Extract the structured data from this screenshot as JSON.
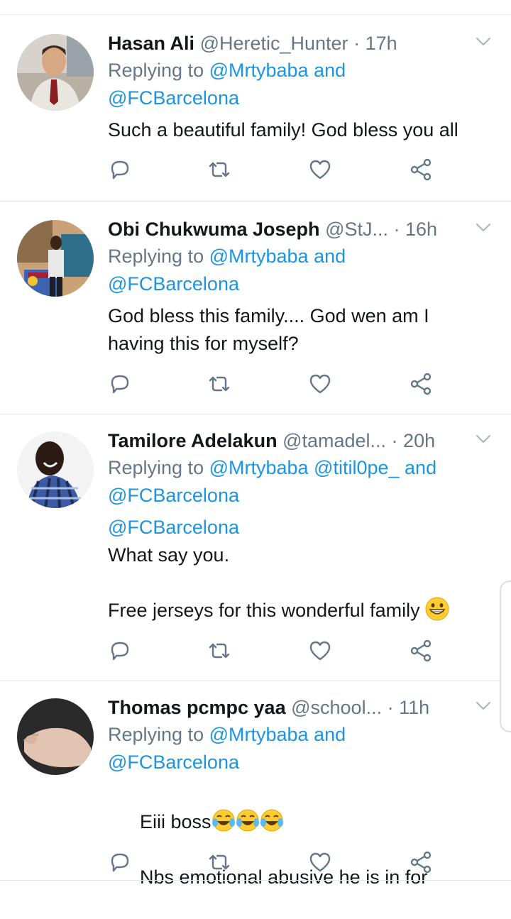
{
  "tweets": [
    {
      "name": "Hasan Ali",
      "handle": "@Heretic_Hunter",
      "dot": " · ",
      "time": "17h",
      "replying_prefix": "Replying to ",
      "replying_line1_mentions": "@Mrtybaba",
      "replying_and": " and",
      "replying_line2": "@FCBarcelona",
      "body": "Such a beautiful family! God bless you all"
    },
    {
      "name": "Obi Chukwuma Joseph",
      "handle": "@StJ...",
      "dot": " · ",
      "time": "16h",
      "replying_prefix": "Replying to ",
      "replying_line1_mentions": "@Mrtybaba",
      "replying_and": " and",
      "replying_line2": "@FCBarcelona",
      "body": "God bless this family.... God wen am I\nhaving this for myself?"
    },
    {
      "name": "Tamilore Adelakun",
      "handle": "@tamadel...",
      "dot": " · ",
      "time": "20h",
      "replying_prefix": "Replying to ",
      "replying_line1_mentions": "@Mrtybaba @titil0pe_",
      "replying_and": " and",
      "replying_line2": "@FCBarcelona",
      "body_mention": "@FCBarcelona",
      "body": "What say you.\n\nFree jerseys for this wonderful family "
    },
    {
      "name": "Thomas pcmpc yaa",
      "handle": "@school...",
      "dot": " · ",
      "time": "11h",
      "replying_prefix": "Replying to ",
      "replying_line1_mentions": "@Mrtybaba",
      "replying_and": " and",
      "replying_line2": "@FCBarcelona",
      "body_line1": "Eiii boss",
      "body_line2": "Nbs emotional abusive he is in for"
    }
  ],
  "icons": {
    "reply": "reply-icon",
    "retweet": "retweet-icon",
    "like": "heart-icon",
    "share": "share-icon",
    "menu": "chevron-down-icon"
  },
  "colors": {
    "mention": "#1b95e0",
    "secondary": "#657786",
    "icon": "#657786",
    "separator": "#e1e8ed"
  }
}
